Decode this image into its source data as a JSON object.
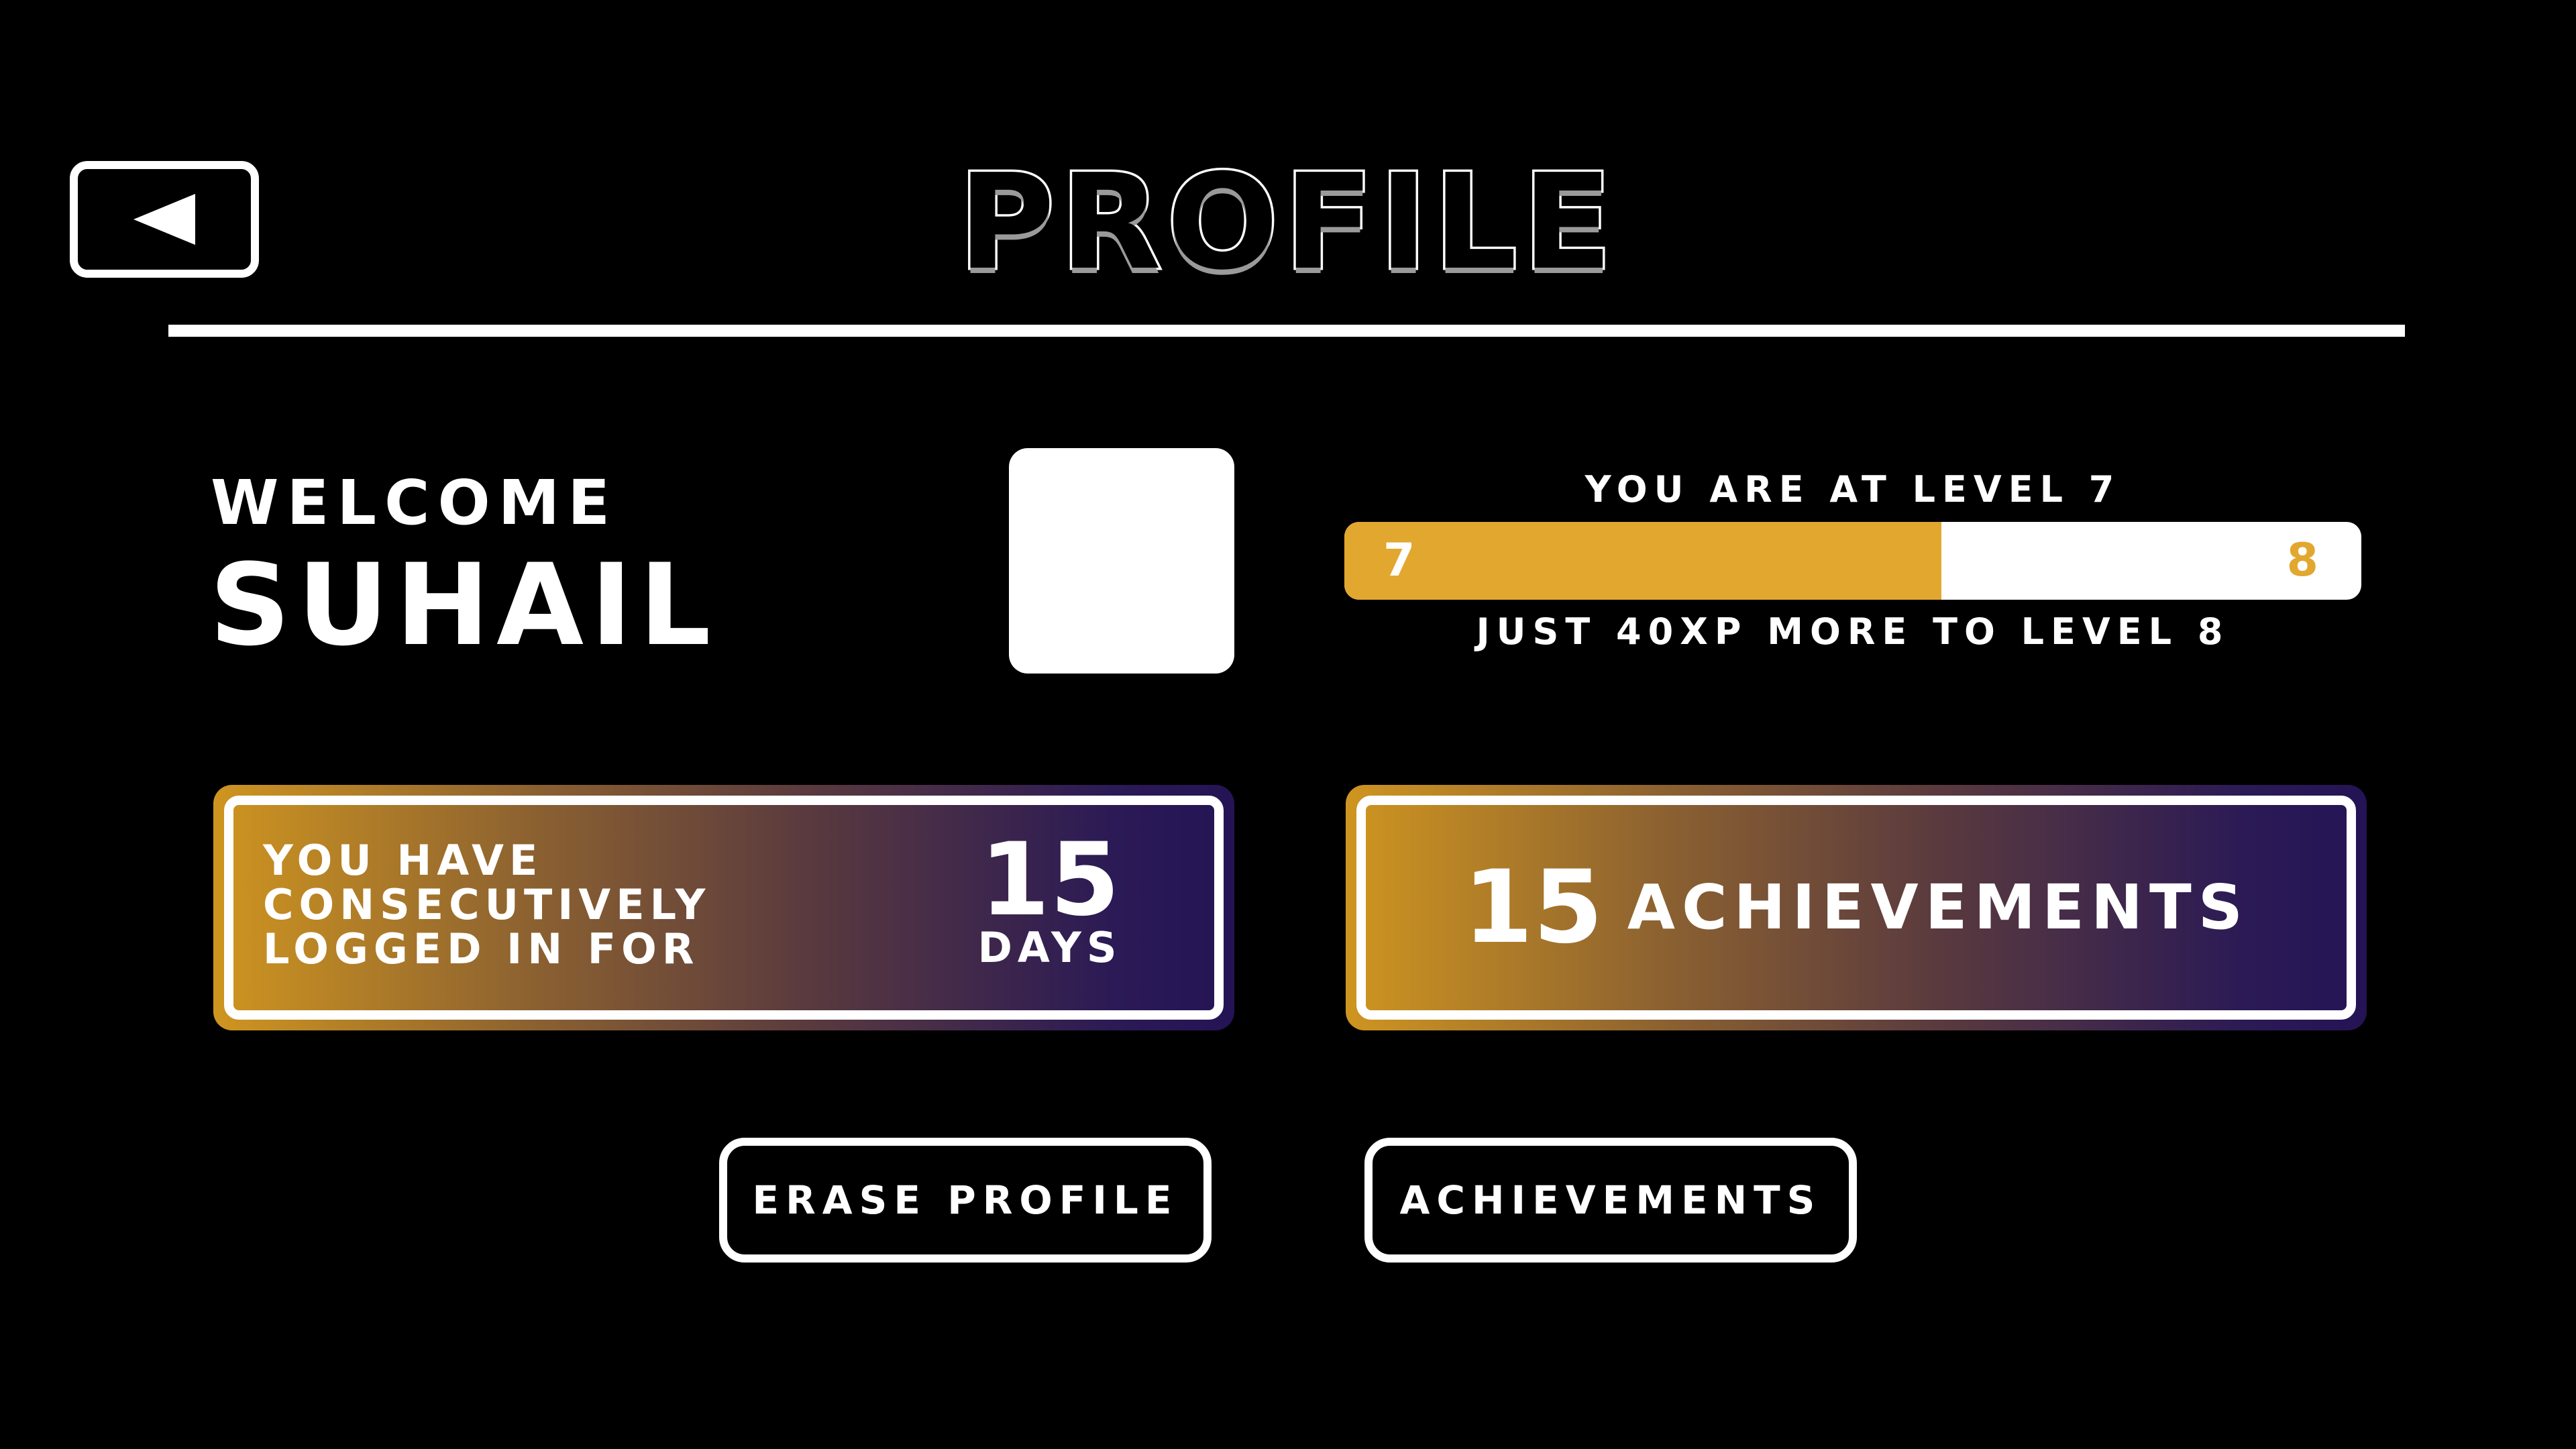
{
  "header": {
    "title": "PROFILE",
    "back_icon": "back-arrow-icon"
  },
  "welcome": {
    "label": "WELCOME",
    "user_name": "SUHAIL"
  },
  "avatar": {
    "color": "#ffffff"
  },
  "level": {
    "title": "YOU ARE AT LEVEL 7",
    "current": "7",
    "next": "8",
    "progress": 0.587,
    "subtitle": "JUST 40XP MORE TO LEVEL 8",
    "fill_color": "#e2a72e"
  },
  "streak_card": {
    "lines": [
      "YOU HAVE",
      "CONSECUTIVELY",
      "LOGGED IN FOR"
    ],
    "number": "15",
    "unit": "DAYS"
  },
  "achievements_card": {
    "number": "15",
    "label": "ACHIEVEMENTS"
  },
  "buttons": {
    "erase_label": "ERASE PROFILE",
    "achievements_label": "ACHIEVEMENTS"
  },
  "colors": {
    "background": "#000000",
    "accent_gold": "#e2a72e",
    "gradient_start": "#cf9520",
    "gradient_end": "#241455"
  }
}
